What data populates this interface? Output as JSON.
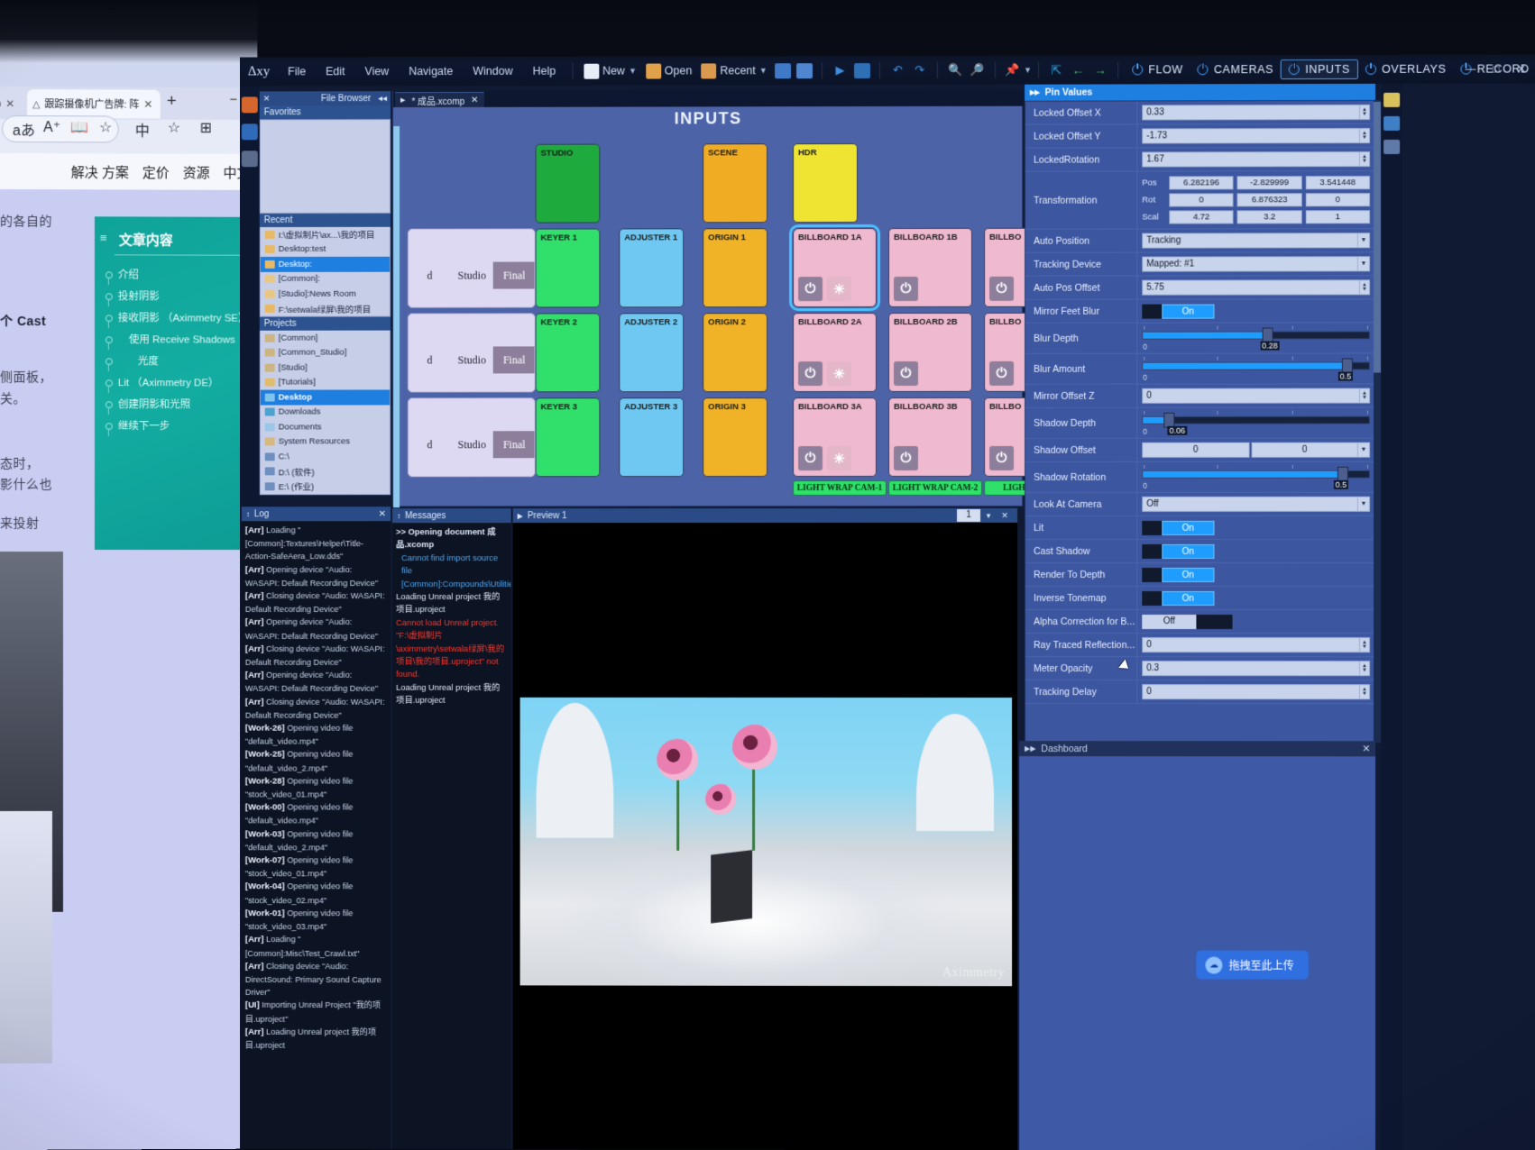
{
  "browser": {
    "tabs": [
      {
        "label": "om",
        "active": false
      },
      {
        "label": "跟踪摄像机广告牌: 阵",
        "active": true
      }
    ],
    "new_tab_icon": "+",
    "collapse_icon": "−",
    "toolbar_icons": [
      "read-aloud-icon",
      "font-size-icon",
      "reading-view-icon",
      "favorite-star-icon",
      "translate-icon",
      "collections-icon",
      "add-collection-icon"
    ],
    "nav_items": [
      "解决 方案",
      "定价",
      "资源",
      "中文"
    ],
    "page_text_left": [
      "的各自的",
      "个  Cast",
      "侧面板，",
      "关。",
      "态时，",
      "影什么也",
      "来投射"
    ],
    "toc": {
      "title": "文章内容",
      "items": [
        {
          "label": "介绍",
          "indent": 0
        },
        {
          "label": "投射阴影",
          "indent": 0
        },
        {
          "label": "接收阴影 （Aximmetry SE）",
          "indent": 0
        },
        {
          "label": "使用 Receive Shadows",
          "indent": 1
        },
        {
          "label": "光度",
          "indent": 2
        },
        {
          "label": "Lit （Aximmetry DE）",
          "indent": 0
        },
        {
          "label": "创建阴影和光照",
          "indent": 0
        },
        {
          "label": "继续下一步",
          "indent": 0
        }
      ]
    }
  },
  "app": {
    "logo": "Δxy",
    "menus": [
      "File",
      "Edit",
      "View",
      "Navigate",
      "Window",
      "Help"
    ],
    "toolbar": [
      {
        "name": "new-button",
        "label": "New",
        "caret": true
      },
      {
        "name": "open-button",
        "label": "Open",
        "caret": false
      },
      {
        "name": "recent-button",
        "label": "Recent",
        "caret": true
      }
    ],
    "modes": [
      {
        "label": "FLOW",
        "selected": false
      },
      {
        "label": "CAMERAS",
        "selected": false
      },
      {
        "label": "INPUTS",
        "selected": true
      },
      {
        "label": "OVERLAYS",
        "selected": false
      },
      {
        "label": "RECORD",
        "selected": false
      }
    ],
    "window_buttons": [
      "minimize",
      "maximize",
      "close"
    ]
  },
  "file_browser": {
    "title": "File Browser",
    "collapse_icon": "◂◂",
    "close_icon": "✕",
    "favorites_label": "Favorites",
    "recent_label": "Recent",
    "recent_items": [
      {
        "label": "I:\\虚拟制片\\ax...\\我的项目",
        "selected": false
      },
      {
        "label": "Desktop:test",
        "selected": false
      },
      {
        "label": "Desktop:",
        "selected": true
      },
      {
        "label": "[Common]:",
        "selected": false
      },
      {
        "label": "[Studio]:News Room",
        "selected": false
      },
      {
        "label": "F:\\setwala绿屏\\我的项目",
        "selected": false
      }
    ],
    "projects_label": "Projects",
    "project_items": [
      {
        "label": "[Common]",
        "selected": false
      },
      {
        "label": "[Common_Studio]",
        "selected": false
      },
      {
        "label": "[Studio]",
        "selected": false
      },
      {
        "label": "[Tutorials]",
        "selected": false
      },
      {
        "label": "Desktop",
        "selected": true
      },
      {
        "label": "Downloads",
        "selected": false
      },
      {
        "label": "Documents",
        "selected": false
      },
      {
        "label": "System Resources",
        "selected": false
      },
      {
        "label": "C:\\",
        "selected": false
      },
      {
        "label": "D:\\ (软件)",
        "selected": false
      },
      {
        "label": "E:\\ (作业)",
        "selected": false
      }
    ]
  },
  "inputs": {
    "doc_tab": "* 成品.xcomp",
    "doc_tab_close": "✕",
    "title": "INPUTS",
    "row0": [
      {
        "label": "STUDIO",
        "color": "#1eaa3c",
        "col": 2
      },
      {
        "label": "SCENE",
        "color": "#f0ac23",
        "col": 4
      },
      {
        "label": "HDR",
        "color": "#efe431",
        "col": 5
      }
    ],
    "rows": [
      {
        "wide": {
          "segments": [
            "d",
            "Studio",
            "Final"
          ],
          "active": 2
        },
        "keyer": "KEYER 1",
        "adjuster": "ADJUSTER 1",
        "origin": "ORIGIN 1",
        "billboards": [
          {
            "label": "BILLBOARD 1A",
            "buttons": [
              "power",
              "light"
            ],
            "selected": true
          },
          {
            "label": "BILLBOARD 1B",
            "buttons": [
              "power"
            ],
            "selected": false
          },
          {
            "label": "BILLBO",
            "buttons": [
              "power"
            ],
            "selected": false
          }
        ]
      },
      {
        "wide": {
          "segments": [
            "d",
            "Studio",
            "Final"
          ],
          "active": 2
        },
        "keyer": "KEYER 2",
        "adjuster": "ADJUSTER 2",
        "origin": "ORIGIN 2",
        "billboards": [
          {
            "label": "BILLBOARD 2A",
            "buttons": [
              "power",
              "light"
            ],
            "selected": false
          },
          {
            "label": "BILLBOARD 2B",
            "buttons": [
              "power"
            ],
            "selected": false
          },
          {
            "label": "BILLBO",
            "buttons": [
              "power"
            ],
            "selected": false
          }
        ]
      },
      {
        "wide": {
          "segments": [
            "d",
            "Studio",
            "Final"
          ],
          "active": 2
        },
        "keyer": "KEYER 3",
        "adjuster": "ADJUSTER 3",
        "origin": "ORIGIN 3",
        "billboards": [
          {
            "label": "BILLBOARD 3A",
            "buttons": [
              "power",
              "light"
            ],
            "selected": false
          },
          {
            "label": "BILLBOARD 3B",
            "buttons": [
              "power"
            ],
            "selected": false
          },
          {
            "label": "BILLBO",
            "buttons": [
              "power"
            ],
            "selected": false
          }
        ]
      }
    ],
    "light_wrap": [
      "LIGHT WRAP CAM-1",
      "LIGHT WRAP CAM-2",
      "LIGHT WRAP"
    ],
    "colors": {
      "keyer": "#31e06b",
      "adjuster": "#6ec8f2",
      "origin": "#f0b328",
      "billboard": "#efb9cf",
      "studio_green": "#1eaa3c",
      "scene_orange": "#f0ac23",
      "hdr_yellow": "#efe431",
      "selection": "#49c2ff"
    }
  },
  "log": {
    "title": "Log",
    "lines": [
      {
        "tag": "[Arr]",
        "text": " Loading \"[Common]:Textures\\Helper\\Title-Action-SafeAera_Low.dds\""
      },
      {
        "tag": "[Arr]",
        "text": " Opening device \"Audio: WASAPI: Default Recording Device\""
      },
      {
        "tag": "[Arr]",
        "text": " Closing device \"Audio: WASAPI: Default Recording Device\""
      },
      {
        "tag": "[Arr]",
        "text": " Opening device \"Audio: WASAPI: Default Recording Device\""
      },
      {
        "tag": "[Arr]",
        "text": " Closing device \"Audio: WASAPI: Default Recording Device\""
      },
      {
        "tag": "[Arr]",
        "text": " Opening device \"Audio: WASAPI: Default Recording Device\""
      },
      {
        "tag": "[Arr]",
        "text": " Closing device \"Audio: WASAPI: Default Recording Device\""
      },
      {
        "tag": "[Work-26]",
        "text": " Opening video file \"default_video.mp4\""
      },
      {
        "tag": "[Work-25]",
        "text": " Opening video file \"default_video_2.mp4\""
      },
      {
        "tag": "[Work-28]",
        "text": " Opening video file \"stock_video_01.mp4\""
      },
      {
        "tag": "[Work-00]",
        "text": " Opening video file \"default_video.mp4\""
      },
      {
        "tag": "[Work-03]",
        "text": " Opening video file \"default_video_2.mp4\""
      },
      {
        "tag": "[Work-07]",
        "text": " Opening video file \"stock_video_01.mp4\""
      },
      {
        "tag": "[Work-04]",
        "text": " Opening video file \"stock_video_02.mp4\""
      },
      {
        "tag": "[Work-01]",
        "text": " Opening video file \"stock_video_03.mp4\""
      },
      {
        "tag": "[Arr]",
        "text": " Loading \"[Common]:Misc\\Test_Crawl.txt\""
      },
      {
        "tag": "[Arr]",
        "text": " Closing device \"Audio: DirectSound: Primary Sound Capture Driver\""
      },
      {
        "tag": "[UI]",
        "text": " Importing Unreal Project \"我的项目.uproject\""
      },
      {
        "tag": "[Arr]",
        "text": " Loading Unreal project 我的项目.uproject"
      }
    ]
  },
  "messages": {
    "title": "Messages",
    "close_icon": "✕",
    "lines": [
      {
        "text": ">> Opening document 成品.xcomp",
        "style": "white"
      },
      {
        "text": "Cannot find import source file [Common]:Compounds\\Utilities\\Video_Recorder.xcomp",
        "style": "blue"
      },
      {
        "text": "Loading Unreal project 我的项目.uproject",
        "style": "white"
      },
      {
        "text": "Cannot load Unreal project. \"F:\\虚拟制片\\aximmetry\\setwala绿屏\\我的项目\\我的项目.uproject\" not found.",
        "style": "red"
      },
      {
        "text": "Loading Unreal project 我的项目.uproject",
        "style": "white"
      }
    ]
  },
  "preview": {
    "title": "Preview 1",
    "page_number": "1",
    "dropdown_icon": "▾",
    "close_icon": "✕",
    "watermark": "Aximmetry"
  },
  "pin_values": {
    "title": "Pin Values",
    "expand_icon": "▸▸",
    "rows": [
      {
        "kind": "text",
        "label": "Locked Offset X",
        "value": "0.33"
      },
      {
        "kind": "text",
        "label": "Locked Offset Y",
        "value": "-1.73"
      },
      {
        "kind": "text",
        "label": "LockedRotation",
        "value": "1.67"
      },
      {
        "kind": "xform",
        "label": "Transformation",
        "pos": [
          "6.282196",
          "-2.829999",
          "3.541448"
        ],
        "rot": [
          "0",
          "6.876323",
          "0"
        ],
        "scal": [
          "4.72",
          "3.2",
          "1"
        ]
      },
      {
        "kind": "combo",
        "label": "Auto Position",
        "value": "Tracking"
      },
      {
        "kind": "combo",
        "label": "Tracking Device",
        "value": "Mapped: #1"
      },
      {
        "kind": "text",
        "label": "Auto Pos Offset",
        "value": "5.75"
      },
      {
        "kind": "toggle",
        "label": "Mirror Feet Blur",
        "value": "On",
        "on": true
      },
      {
        "kind": "slider",
        "label": "Blur Depth",
        "value": "0.28",
        "min": "0",
        "pct": 55
      },
      {
        "kind": "slider",
        "label": "Blur Amount",
        "value": "0.5",
        "min": "0",
        "pct": 90
      },
      {
        "kind": "text",
        "label": "Mirror Offset Z",
        "value": "0"
      },
      {
        "kind": "slider",
        "label": "Shadow Depth",
        "value": "0.06",
        "min": "0",
        "pct": 12
      },
      {
        "kind": "dual",
        "label": "Shadow Offset",
        "values": [
          "0",
          "0"
        ]
      },
      {
        "kind": "slider",
        "label": "Shadow Rotation",
        "value": "0.5",
        "min": "0",
        "pct": 88
      },
      {
        "kind": "combo",
        "label": "Look At Camera",
        "value": "Off"
      },
      {
        "kind": "toggle",
        "label": "Lit",
        "value": "On",
        "on": true
      },
      {
        "kind": "toggle",
        "label": "Cast Shadow",
        "value": "On",
        "on": true
      },
      {
        "kind": "toggle",
        "label": "Render To Depth",
        "value": "On",
        "on": true
      },
      {
        "kind": "toggle",
        "label": "Inverse Tonemap",
        "value": "On",
        "on": true
      },
      {
        "kind": "toggleoff",
        "label": "Alpha Correction for B...",
        "value": "Off",
        "on": false
      },
      {
        "kind": "text",
        "label": "Ray Traced Reflection...",
        "value": "0"
      },
      {
        "kind": "text",
        "label": "Meter Opacity",
        "value": "0.3"
      },
      {
        "kind": "text",
        "label": "Tracking Delay",
        "value": "0"
      }
    ]
  },
  "dashboard": {
    "title": "Dashboard",
    "close_icon": "✕",
    "upload_label": "拖拽至此上传",
    "upload_icon": "cloud-upload-icon"
  }
}
